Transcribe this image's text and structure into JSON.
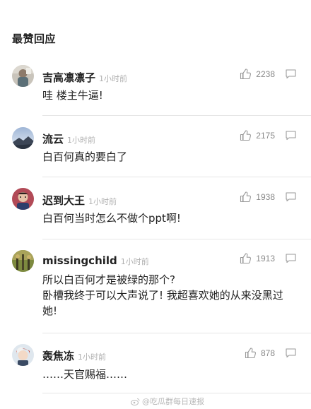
{
  "section": {
    "title": "最赞回应"
  },
  "comments": [
    {
      "username": "吉高凛凛子",
      "time": "1小时前",
      "likes": "2238",
      "text": "哇 楼主牛逼!"
    },
    {
      "username": "流云",
      "time": "1小时前",
      "likes": "2175",
      "text": "白百何真的要白了"
    },
    {
      "username": "迟到大王",
      "time": "1小时前",
      "likes": "1938",
      "text": "白百何当时怎么不做个ppt啊!"
    },
    {
      "username": "missingchild",
      "time": "1小时前",
      "likes": "1913",
      "text": "所以白百何才是被绿的那个?\n卧槽我终于可以大声说了! 我超喜欢她的从来没黑过她!"
    },
    {
      "username": "轰焦冻",
      "time": "1小时前",
      "likes": "878",
      "text": "……天官赐福……"
    }
  ],
  "watermark": {
    "text": "@吃瓜群每日速报"
  },
  "icons": {
    "like": "thumbs-up-icon",
    "reply": "speech-bubble-icon",
    "watermark": "weibo-icon"
  },
  "colors": {
    "username": "#222222",
    "time": "#b0b0b0",
    "count": "#8a8a8a",
    "divider": "#e6e6e6"
  }
}
